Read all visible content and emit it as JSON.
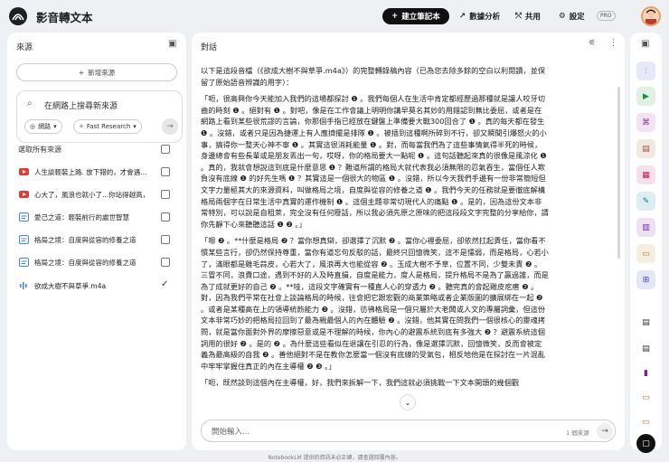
{
  "header": {
    "app_title": "影音轉文本",
    "create_notebook": "建立筆記本",
    "analytics": "數據分析",
    "share": "共用",
    "settings": "設定",
    "pro_badge": "PRO"
  },
  "sources_panel": {
    "title": "來源",
    "add_source": "新增來源",
    "search_placeholder": "在網路上搜尋新來源",
    "chip_web": "網路",
    "chip_research": "Fast Research",
    "select_all": "選取所有來源",
    "items": [
      {
        "label": "人生談輕裝上路. 放下錯的，才會遇...",
        "icon": "youtube-icon",
        "checked": false
      },
      {
        "label": "心大了，風浪也就小了...你站得越高，...",
        "icon": "youtube-icon",
        "checked": false
      },
      {
        "label": "愛己之道：輕裝前行的處世智慧",
        "icon": "document-icon",
        "checked": false
      },
      {
        "label": "格局之境：自度與從容的修養之道",
        "icon": "document-icon",
        "checked": false
      },
      {
        "label": "格局之境：自度與從容的修養之道",
        "icon": "document-icon",
        "checked": false
      },
      {
        "label": "欲成大樹不與草爭.m4a",
        "icon": "audio-icon",
        "checked": true
      }
    ]
  },
  "chat_panel": {
    "title": "對話",
    "paragraphs": [
      {
        "id": "intro",
        "text": "以下是這段音檔（《欲成大樹不與草爭.m4a》）的完整轉錄稿內容（已為您去除多餘的空白以利閱讀，並保留了原始語音辨識的用字）："
      },
      {
        "id": "p1",
        "text": "「呃，很高興你今天能加入我們的這場都探討 ❶ 。我們每個人在生活中肯定都經歷過那種就是讓人咬牙切齒的時刻 ❶ 。絕對有 ❶ 。對吧，像是在工作會議上明明你講早莫名其妙的用錯認到無比委屈，或者是在網路上看到某些很荒謬的言論，你那個手指已經放在鍵盤上準備要大戰300回合了 ❶ 。真的每天都在發生 ❶ 。沒錯，或者只是因為捷運上有人應擠擺是排隊 ❶ 。被插到這種啊所碎到不行，卻又瞬間引爆怒火的小事，搞得你一整天心神不寧 ❶ 。其實這很消耗能量 ❶ 。對，而每當我們為了這些事情氣得半死的時候，身邊總會有些長輩或是朋友丟出一句，哎呀，你的格局要大一點呢 ❶ 。這句話聽起來真的很像是風涼化 ❶ 。真的，我就會想說這到底是什麼意思 ❶ ？難道所謂的格局大就代表我必須無限的忍氣吞生，當個任人欺負沒有底線 ❶ 的好先生嗎 ❶ ？其實這是一個很大的物區 ❶ 。沒錯，所以今天我們手邊有一份非常簡短但文字力量極其大的來源資料，叫做格局之境，自度與從容的修養之道 ❶ 。我們今天的任務就是要徹底解構格局兩個字在日常生活中真實的運作機制 ❶ 。這個主題非常切現代人的痛點 ❶ 。是的，因為這份文本非常特別，可以說是自租萊，完全沒有任何廢話，所以我必須先原之原味的把這段段文字完整的分享給你，請你先靜下心來聽聽這話 ❶ ❷ 。」"
      },
      {
        "id": "p2",
        "text": "「嗯 ❷ 。**什麼是格局 ❷ ？當你想真辯，卻選擇了沉默 ❷ 。當你心裡委屈，卻依然扛起責任，當你看不慣某些言行，卻仍然保持尊重，當你有道忘句反駁的話，最終只回憶微笑，這不是懦弱，而是格局，心若小了，滿眼都是雞毛蒜皮，心若大了，風浪再大也能從容 ❷ 。玉成大樹不予草，位置不同，少雙未責 ❷ 。三冒不同，浪費口途，遇到不好的人及時直損，自度是能力，度人是格局，提升格局不是為了贏過誰，而是為了成就更好的自己 ❷ 。**哇，這段文字確實有一種直人心的穿透力 ❷ 。聽完真的會起雞皮疙瘩 ❷ 。對，因為我們平常在社會上談論格局的時候，往會把它跟宏觀的商業策略或者企業版圖的擴展綁在一起 ❷ 。或者是某種高在上的領導統飭能力 ❷ 。沒錯，彷彿格局是一個只屬於大老闆或人文的專屬詞彙，但這份文本非常巧妙的把格局拉回到了最為親最個人的內在體驗 ❷ 。沒錯，他其實在問我們一個很核心的靈魂拷問，就是當你面對外界的摩擦惡意或是不理解的時候，你內心的避震系統到底有多強大 ❷ ？避震系統這個詞用的很好 ❷ 。是的 ❷ 。為什麼這些看似在退讓在引忍的行為，像是選擇沉默，回憶微笑，反而會被定義為最高級的自我 ❷ 。善他絕對不是在教你怎麼當一個沒有底線的受氣包，相反地他是在探討在一片混亂中牢牢掌握住真正的內在主導權 ❷ ❸ 。」"
      },
      {
        "id": "p3",
        "text": "「呃，既然談到這個內在主導權，好，我們來拆解一下，我們這就必須挑戰一下文本開頭的幾個觀"
      }
    ],
    "input_placeholder": "開始輸入...",
    "source_count": "1 個來源"
  },
  "footer": {
    "disclaimer": "NotebookLM 提供的資訊未必正確，請查證回覆內容。"
  },
  "studio_icons": [
    {
      "name": "audio-overview-icon",
      "color": "#5b4fd6"
    },
    {
      "name": "video-overview-icon",
      "color": "#1e8e3e"
    },
    {
      "name": "mind-map-icon",
      "color": "#9c27b0"
    },
    {
      "name": "report-icon",
      "color": "#a0522d"
    },
    {
      "name": "flashcards-icon",
      "color": "#c2185b"
    },
    {
      "name": "quiz-icon",
      "color": "#00838f"
    },
    {
      "name": "infographic-icon",
      "color": "#7b1fa2"
    },
    {
      "name": "slides-icon",
      "color": "#b7791f"
    },
    {
      "name": "data-table-icon",
      "color": "#3949ab"
    },
    {
      "name": "note-icon-1",
      "color": "#333333"
    },
    {
      "name": "note-icon-2",
      "color": "#333333"
    },
    {
      "name": "bar-chart-icon",
      "color": "#7b1fa2"
    },
    {
      "name": "slides-icon-2",
      "color": "#b7791f"
    },
    {
      "name": "slides-icon-3",
      "color": "#b7791f"
    },
    {
      "name": "add-note-icon",
      "color": "#111111"
    }
  ]
}
